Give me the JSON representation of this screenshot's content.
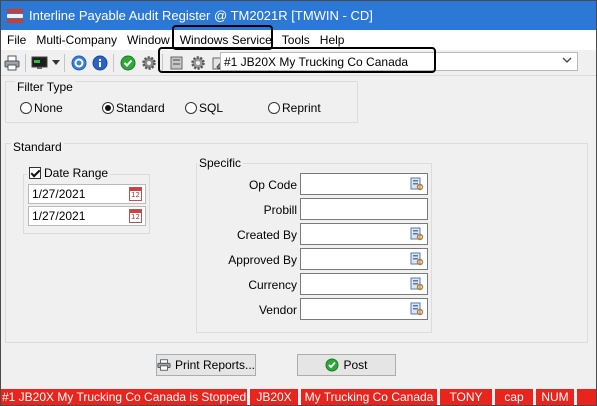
{
  "window": {
    "title": "Interline Payable Audit Register @ TM2021R [TMWIN - CD]"
  },
  "menu": {
    "items": [
      "File",
      "Multi-Company",
      "Window",
      "Windows Service",
      "Tools",
      "Help"
    ]
  },
  "toolbar": {
    "icons": [
      "printer-icon",
      "monitor-icon",
      "dropdown-arrow-icon",
      "help-icon",
      "info-icon",
      "check-icon",
      "settings-icon",
      "stop-service-icon",
      "service-gear-icon",
      "pencil-icon"
    ],
    "company_value": "#1 JB20X My Trucking Co Canada"
  },
  "filter_type": {
    "legend": "Filter Type",
    "options": [
      "None",
      "Standard",
      "SQL",
      "Reprint"
    ],
    "selected": "Standard"
  },
  "standard": {
    "legend": "Standard",
    "date_range_label": "Date Range",
    "date_range_checked": true,
    "date_from": "1/27/2021",
    "date_to": "1/27/2021",
    "calendar_icon": "calendar-icon"
  },
  "specific": {
    "legend": "Specific",
    "fields": [
      {
        "label": "Op Code",
        "value": "",
        "lookup": true
      },
      {
        "label": "Probill",
        "value": "",
        "lookup": false
      },
      {
        "label": "Created By",
        "value": "",
        "lookup": true
      },
      {
        "label": "Approved By",
        "value": "",
        "lookup": true
      },
      {
        "label": "Currency",
        "value": "",
        "lookup": true
      },
      {
        "label": "Vendor",
        "value": "",
        "lookup": true
      }
    ]
  },
  "buttons": {
    "print_label": "Print Reports...",
    "print_mnemonic": "P",
    "post_label": "Post",
    "post_mnemonic": "P"
  },
  "status": {
    "message": "#1 JB20X My Trucking Co Canada is Stopped",
    "company_code": "JB20X",
    "company_name": "My Trucking Co Canada",
    "user": "TONY",
    "caps": "cap",
    "num": "NUM",
    "color": "#e8241c"
  },
  "colors": {
    "titlebar": "#2b78d6",
    "status": "#e8241c"
  }
}
